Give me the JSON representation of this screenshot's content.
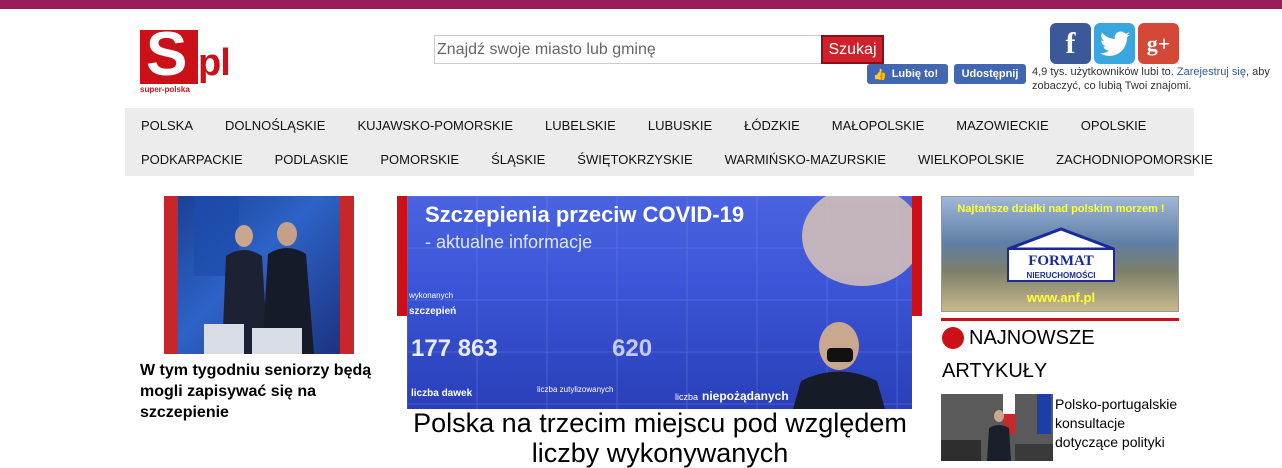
{
  "header": {
    "logo_main": "S",
    "logo_suffix": "pl",
    "logo_sub": "super-polska",
    "search_placeholder": "Znajdź swoje miasto lub gminę",
    "search_button": "Szukaj"
  },
  "social": {
    "facebook_glyph": "f",
    "googleplus_glyph": "g+",
    "like_label": "Lubię to!",
    "share_label": "Udostępnij",
    "likes_text_a": "4,9 tys. użytkowników lubi to.",
    "register_link": "Zarejestruj się",
    "likes_text_b": ", aby zobaczyć, co lubią Twoi znajomi."
  },
  "nav": {
    "row1": [
      "POLSKA",
      "DOLNOŚLĄSKIE",
      "KUJAWSKO-POMORSKIE",
      "LUBELSKIE",
      "LUBUSKIE",
      "ŁÓDZKIE",
      "MAŁOPOLSKIE",
      "MAZOWIECKIE",
      "OPOLSKIE"
    ],
    "row2": [
      "PODKARPACKIE",
      "PODLASKIE",
      "POMORSKIE",
      "ŚLĄSKIE",
      "ŚWIĘTOKRZYSKIE",
      "WARMIŃSKO-MAZURSKIE",
      "WIELKOPOLSKIE",
      "ZACHODNIOPOMORSKIE"
    ]
  },
  "left_article": {
    "title": "W tym tygodniu seniorzy będą mogli zapisywać się na szczepienie"
  },
  "main_article": {
    "image_heading": "Szczepienia przeciw COVID-19",
    "image_sub": "- aktualne informacje",
    "image_label_1": "wykonanych",
    "image_label_2": "szczepień",
    "image_number": "177 863",
    "image_number_2": "620",
    "image_label_3": "liczba dawek",
    "image_label_4": "liczba zutylizowanych",
    "image_label_5a": "liczba",
    "image_label_5b": "niepożądanych",
    "title": "Polska na trzecim miejscu pod względem liczby wykonywanych"
  },
  "ad": {
    "top_text": "Najtańsze działki nad polskim morzem !",
    "brand": "FORMAT",
    "brand_sub": "NIERUCHOMOŚCI",
    "url": "www.anf.pl"
  },
  "latest": {
    "heading": "NAJNOWSZE ARTYKUŁY",
    "items": [
      {
        "title": "Polsko-portugalskie konsultacje dotyczące polityki"
      }
    ]
  },
  "colors": {
    "brand_red": "#cc1018",
    "top_bar": "#9b1c5a",
    "facebook": "#3b5998",
    "twitter": "#3aa6e0",
    "googleplus": "#d34836"
  }
}
